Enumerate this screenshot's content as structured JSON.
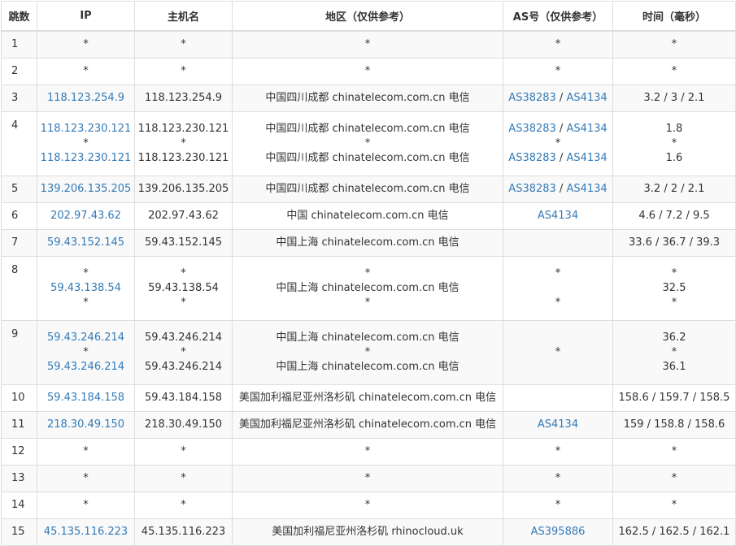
{
  "headers": {
    "hop": "跳数",
    "ip": "IP",
    "hostname": "主机名",
    "region": "地区（仅供参考）",
    "as": "AS号（仅供参考）",
    "time": "时间（毫秒）"
  },
  "rows": [
    {
      "hop": "1",
      "ip": [
        "*"
      ],
      "host": [
        "*"
      ],
      "region": [
        "*"
      ],
      "as": [
        [
          "*"
        ]
      ],
      "time": [
        "*"
      ]
    },
    {
      "hop": "2",
      "ip": [
        "*"
      ],
      "host": [
        "*"
      ],
      "region": [
        "*"
      ],
      "as": [
        [
          "*"
        ]
      ],
      "time": [
        "*"
      ]
    },
    {
      "hop": "3",
      "ip": [
        "118.123.254.9"
      ],
      "host": [
        "118.123.254.9"
      ],
      "region": [
        "中国四川成都 chinatelecom.com.cn 电信"
      ],
      "as": [
        [
          "AS38283",
          "AS4134"
        ]
      ],
      "time": [
        "3.2 / 3 / 2.1"
      ]
    },
    {
      "hop": "4",
      "ip": [
        "118.123.230.121",
        "*",
        "118.123.230.121"
      ],
      "host": [
        "118.123.230.121",
        "*",
        "118.123.230.121"
      ],
      "region": [
        "中国四川成都 chinatelecom.com.cn 电信",
        "*",
        "中国四川成都 chinatelecom.com.cn 电信"
      ],
      "as": [
        [
          "AS38283",
          "AS4134"
        ],
        [
          "*"
        ],
        [
          "AS38283",
          "AS4134"
        ]
      ],
      "time": [
        "1.8",
        "*",
        "1.6"
      ]
    },
    {
      "hop": "5",
      "ip": [
        "139.206.135.205"
      ],
      "host": [
        "139.206.135.205"
      ],
      "region": [
        "中国四川成都 chinatelecom.com.cn 电信"
      ],
      "as": [
        [
          "AS38283",
          "AS4134"
        ]
      ],
      "time": [
        "3.2 / 2 / 2.1"
      ]
    },
    {
      "hop": "6",
      "ip": [
        "202.97.43.62"
      ],
      "host": [
        "202.97.43.62"
      ],
      "region": [
        "中国 chinatelecom.com.cn 电信"
      ],
      "as": [
        [
          "AS4134"
        ]
      ],
      "time": [
        "4.6 / 7.2 / 9.5"
      ]
    },
    {
      "hop": "7",
      "ip": [
        "59.43.152.145"
      ],
      "host": [
        "59.43.152.145"
      ],
      "region": [
        "中国上海 chinatelecom.com.cn 电信"
      ],
      "as": [],
      "time": [
        "33.6 / 36.7 / 39.3"
      ]
    },
    {
      "hop": "8",
      "ip": [
        "*",
        "59.43.138.54",
        "*"
      ],
      "host": [
        "*",
        "59.43.138.54",
        "*"
      ],
      "region": [
        "*",
        "中国上海 chinatelecom.com.cn 电信",
        "*"
      ],
      "as": [
        [
          "*"
        ],
        [],
        [
          "*"
        ]
      ],
      "time": [
        "*",
        "32.5",
        "*"
      ]
    },
    {
      "hop": "9",
      "ip": [
        "59.43.246.214",
        "*",
        "59.43.246.214"
      ],
      "host": [
        "59.43.246.214",
        "*",
        "59.43.246.214"
      ],
      "region": [
        "中国上海 chinatelecom.com.cn 电信",
        "*",
        "中国上海 chinatelecom.com.cn 电信"
      ],
      "as": [
        [],
        [
          "*"
        ],
        []
      ],
      "time": [
        "36.2",
        "*",
        "36.1"
      ]
    },
    {
      "hop": "10",
      "ip": [
        "59.43.184.158"
      ],
      "host": [
        "59.43.184.158"
      ],
      "region": [
        "美国加利福尼亚州洛杉矶 chinatelecom.com.cn 电信"
      ],
      "as": [],
      "time": [
        "158.6 / 159.7 / 158.5"
      ]
    },
    {
      "hop": "11",
      "ip": [
        "218.30.49.150"
      ],
      "host": [
        "218.30.49.150"
      ],
      "region": [
        "美国加利福尼亚州洛杉矶 chinatelecom.com.cn 电信"
      ],
      "as": [
        [
          "AS4134"
        ]
      ],
      "time": [
        "159 / 158.8 / 158.6"
      ]
    },
    {
      "hop": "12",
      "ip": [
        "*"
      ],
      "host": [
        "*"
      ],
      "region": [
        "*"
      ],
      "as": [
        [
          "*"
        ]
      ],
      "time": [
        "*"
      ]
    },
    {
      "hop": "13",
      "ip": [
        "*"
      ],
      "host": [
        "*"
      ],
      "region": [
        "*"
      ],
      "as": [
        [
          "*"
        ]
      ],
      "time": [
        "*"
      ]
    },
    {
      "hop": "14",
      "ip": [
        "*"
      ],
      "host": [
        "*"
      ],
      "region": [
        "*"
      ],
      "as": [
        [
          "*"
        ]
      ],
      "time": [
        "*"
      ]
    },
    {
      "hop": "15",
      "ip": [
        "45.135.116.223"
      ],
      "host": [
        "45.135.116.223"
      ],
      "region": [
        "美国加利福尼亚州洛杉矶 rhinocloud.uk"
      ],
      "as": [
        [
          "AS395886"
        ]
      ],
      "time": [
        "162.5 / 162.5 / 162.1"
      ]
    }
  ],
  "colors": {
    "link": "#337ab7",
    "text": "#333333",
    "border": "#dddddd",
    "stripe": "#f9f9f9"
  }
}
